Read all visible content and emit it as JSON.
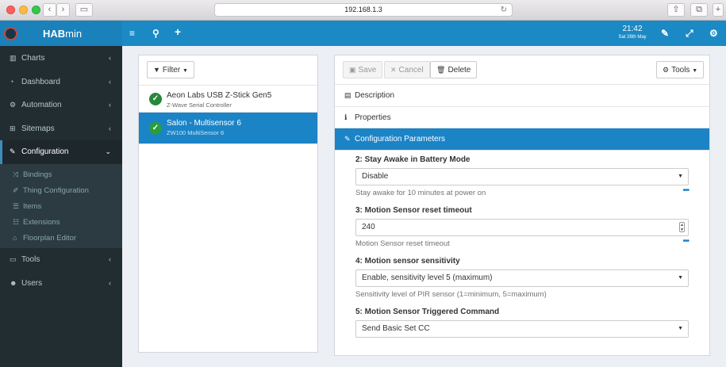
{
  "browser": {
    "url": "192.168.1.3"
  },
  "app": {
    "brand_bold": "HAB",
    "brand_rest": "min",
    "time": "21:42",
    "date": "Sat 28th May"
  },
  "sidebar": {
    "items": [
      {
        "label": "Charts"
      },
      {
        "label": "Dashboard"
      },
      {
        "label": "Automation"
      },
      {
        "label": "Sitemaps"
      },
      {
        "label": "Configuration"
      },
      {
        "label": "Tools"
      },
      {
        "label": "Users"
      }
    ],
    "config_sub": [
      {
        "label": "Bindings"
      },
      {
        "label": "Thing Configuration"
      },
      {
        "label": "Items"
      },
      {
        "label": "Extensions"
      },
      {
        "label": "Floorplan Editor"
      }
    ]
  },
  "left_panel": {
    "filter_label": "Filter",
    "devices": [
      {
        "name": "Aeon Labs USB Z-Stick Gen5",
        "sub": "Z-Wave Serial Controller"
      },
      {
        "name": "Salon - Multisensor 6",
        "sub": "ZW100 MultiSensor 6"
      }
    ]
  },
  "right_panel": {
    "save_label": "Save",
    "cancel_label": "Cancel",
    "delete_label": "Delete",
    "tools_label": "Tools",
    "sections": [
      {
        "label": "Description"
      },
      {
        "label": "Properties"
      },
      {
        "label": "Configuration Parameters"
      }
    ],
    "params": [
      {
        "label": "2: Stay Awake in Battery Mode",
        "value": "Disable",
        "help": "Stay awake for 10 minutes at power on"
      },
      {
        "label": "3: Motion Sensor reset timeout",
        "value": "240",
        "help": "Motion Sensor reset timeout"
      },
      {
        "label": "4: Motion sensor sensitivity",
        "value": "Enable, sensitivity level 5 (maximum)",
        "help": "Sensitivity level of PIR sensor (1=minimum, 5=maximum)"
      },
      {
        "label": "5: Motion Sensor Triggered Command",
        "value": "Send Basic Set CC"
      }
    ],
    "more_glyph": "•••"
  }
}
